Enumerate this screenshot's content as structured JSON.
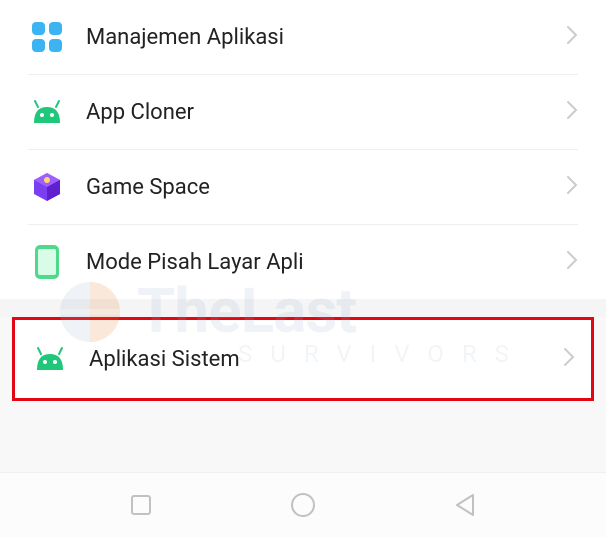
{
  "settings": {
    "items": [
      {
        "label": "Manajemen Aplikasi",
        "icon": "apps-grid-icon"
      },
      {
        "label": "App Cloner",
        "icon": "android-head-icon"
      },
      {
        "label": "Game Space",
        "icon": "cube-icon"
      },
      {
        "label": "Mode Pisah Layar Apli",
        "icon": "phone-split-icon"
      },
      {
        "label": "Aplikasi Sistem",
        "icon": "android-head-icon"
      }
    ]
  },
  "watermark": {
    "text": "TheLast",
    "subtext": "SURVIVORS"
  }
}
